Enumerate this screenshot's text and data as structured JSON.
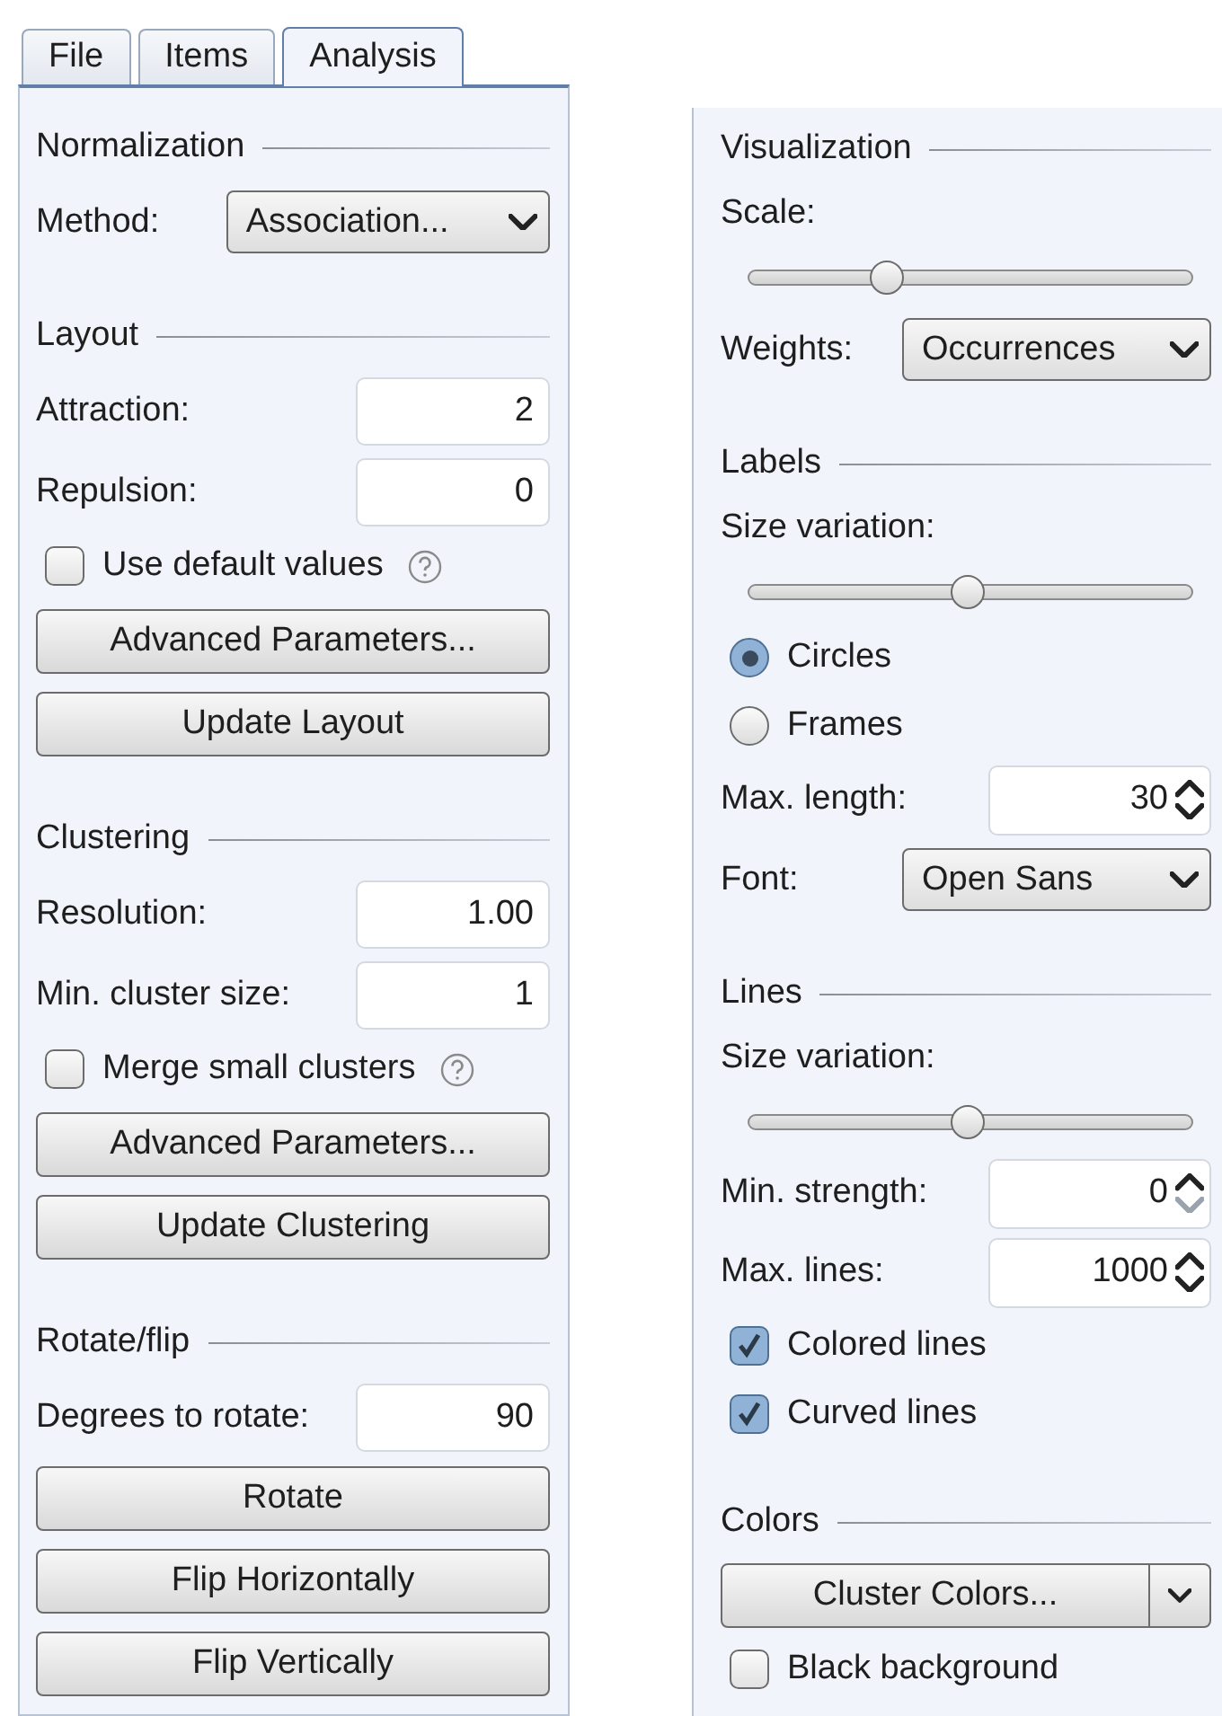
{
  "tabs": [
    {
      "label": "File",
      "selected": false
    },
    {
      "label": "Items",
      "selected": false
    },
    {
      "label": "Analysis",
      "selected": true
    }
  ],
  "panels": [
    {
      "sections": [
        {
          "title": "Normalization",
          "rows": [
            {
              "kind": "select",
              "label": "Method:",
              "value": "Association..."
            }
          ]
        },
        {
          "title": "Layout",
          "rows": [
            {
              "kind": "number",
              "label": "Attraction:",
              "value": "2"
            },
            {
              "kind": "number",
              "label": "Repulsion:",
              "value": "0"
            },
            {
              "kind": "checkbox",
              "label": "Use default values",
              "checked": false,
              "help": true
            },
            {
              "kind": "button",
              "label": "Advanced Parameters..."
            },
            {
              "kind": "button",
              "label": "Update Layout"
            }
          ]
        },
        {
          "title": "Clustering",
          "rows": [
            {
              "kind": "number",
              "label": "Resolution:",
              "value": "1.00"
            },
            {
              "kind": "number",
              "label": "Min. cluster size:",
              "value": "1"
            },
            {
              "kind": "checkbox",
              "label": "Merge small clusters",
              "checked": false,
              "help": true
            },
            {
              "kind": "button",
              "label": "Advanced Parameters..."
            },
            {
              "kind": "button",
              "label": "Update Clustering"
            }
          ]
        },
        {
          "title": "Rotate/flip",
          "rows": [
            {
              "kind": "number",
              "label": "Degrees to rotate:",
              "value": "90"
            },
            {
              "kind": "button",
              "label": "Rotate"
            },
            {
              "kind": "button",
              "label": "Flip Horizontally"
            },
            {
              "kind": "button",
              "label": "Flip Vertically"
            }
          ]
        }
      ]
    },
    {
      "sections": [
        {
          "title": "Visualization",
          "rows": [
            {
              "kind": "label",
              "label": "Scale:"
            },
            {
              "kind": "slider",
              "level": 0.31
            },
            {
              "kind": "select",
              "label": "Weights:",
              "value": "Occurrences"
            }
          ]
        },
        {
          "title": "Labels",
          "rows": [
            {
              "kind": "label",
              "label": "Size variation:"
            },
            {
              "kind": "slider",
              "level": 0.49
            },
            {
              "kind": "radio",
              "label": "Circles",
              "selected": true
            },
            {
              "kind": "radio",
              "label": "Frames",
              "selected": false
            },
            {
              "kind": "spinner",
              "label": "Max. length:",
              "value": "30",
              "decrement_disabled": false
            },
            {
              "kind": "select",
              "label": "Font:",
              "value": "Open Sans"
            }
          ]
        },
        {
          "title": "Lines",
          "rows": [
            {
              "kind": "label",
              "label": "Size variation:"
            },
            {
              "kind": "slider",
              "level": 0.49
            },
            {
              "kind": "spinner",
              "label": "Min. strength:",
              "value": "0",
              "decrement_disabled": true
            },
            {
              "kind": "spinner",
              "label": "Max. lines:",
              "value": "1000",
              "decrement_disabled": false
            },
            {
              "kind": "checkbox",
              "label": "Colored lines",
              "checked": true,
              "help": false
            },
            {
              "kind": "checkbox",
              "label": "Curved lines",
              "checked": true,
              "help": false
            }
          ]
        },
        {
          "title": "Colors",
          "rows": [
            {
              "kind": "splitbutton",
              "label": "Cluster Colors..."
            },
            {
              "kind": "checkbox",
              "label": "Black background",
              "checked": false,
              "help": false
            }
          ]
        }
      ]
    }
  ]
}
